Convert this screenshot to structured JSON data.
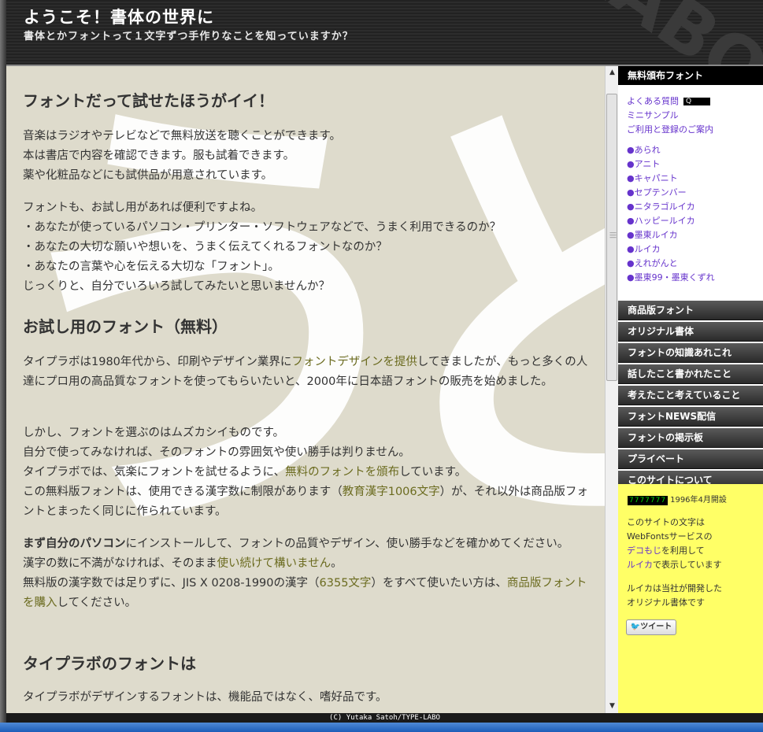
{
  "header": {
    "title": "ようこそ！書体の世界に",
    "subtitle": "書体とかフォントって１文字ずつ手作りなことを知っていますか？"
  },
  "main": {
    "deco_text": "ありがとう",
    "h1": "フォントだって試せたほうがイイ！",
    "p1_l1": "音楽はラジオやテレビなどで無料放送を聴くことができます。",
    "p1_l2": "本は書店で内容を確認できます。服も試着できます。",
    "p1_l3": "薬や化粧品などにも試供品が用意されています。",
    "p2_l1": "フォントも、お試し用があれば便利ですよね。",
    "p2_l2": "・あなたが使っているパソコン・プリンター・ソフトウェアなどで、うまく利用できるのか？",
    "p2_l3": "・あなたの大切な願いや想いを、うまく伝えてくれるフォントなのか？",
    "p2_l4": "・あなたの言葉や心を伝える大切な「フォント」。",
    "p2_l5": "じっくりと、自分でいろいろ試してみたいと思いませんか？",
    "h2": "お試し用のフォント（無料）",
    "p3_a": "タイプラボは1980年代から、印刷やデザイン業界に",
    "p3_link": "フォントデザインを提供",
    "p3_b": "してきましたが、もっと多くの人達にプロ用の高品質なフォントを使ってもらいたいと、2000年に日本語フォントの販売を始めました。",
    "p4_l1": "しかし、フォントを選ぶのはムズカシイものです。",
    "p4_l2": "自分で使ってみなければ、そのフォントの雰囲気や使い勝手は判りません。",
    "p4_l3a": "タイプラボでは、気楽にフォントを試せるように、",
    "p4_l3link": "無料のフォントを頒布",
    "p4_l3b": "しています。",
    "p4_l4a": "この無料版フォントは、使用できる漢字数に制限があります（",
    "p4_l4link": "教育漢字1006文字",
    "p4_l4b": "）が、それ以外は商品版フォントとまったく同じに作られています。",
    "p5_bold": "まず自分のパソコン",
    "p5_l1b": "にインストールして、フォントの品質やデザイン、使い勝手などを確かめてください。",
    "p5_l2a": "漢字の数に不満がなければ、そのまま",
    "p5_l2link": "使い続けて構いません",
    "p5_l2b": "。",
    "p5_l3a": "無料版の漢字数では足りずに、JIS X 0208-1990の漢字（",
    "p5_l3link": "6355文字",
    "p5_l3b": "）をすべて使いたい方は、",
    "p5_l3link2": "商品版フォントを購入",
    "p5_l3c": "してください。",
    "h3": "タイプラボのフォントは",
    "p6_l1": "タイプラボがデザインするフォントは、機能品ではなく、嗜好品です。"
  },
  "sidebar": {
    "head": "無料頒布フォント",
    "links": [
      "よくある質問",
      "ミニサンプル",
      "ご利用と登録のご案内"
    ],
    "q_badge": "Q",
    "fonts": [
      "●あられ",
      "●アニト",
      "●キャパニト",
      "●セプテンバー",
      "●ニタラゴルイカ",
      "●ハッピールイカ",
      "●墨東ルイカ",
      "●ルイカ",
      "●えれがんと",
      "●墨東99・墨東くずれ"
    ],
    "menu": [
      "商品版フォント",
      "オリジナル書体",
      "フォントの知識あれこれ",
      "話したこと書かれたこと",
      "考えたこと考えていること",
      "フォントNEWS配信",
      "フォントの掲示板",
      "プライベート",
      "このサイトについて"
    ],
    "counter": "7777777",
    "since": "1996年4月開設",
    "info_l1": "このサイトの文字は",
    "info_l2": "WebFontsサービスの",
    "info_l3a": "デコもじ",
    "info_l3b": "を利用して",
    "info_l4a": "ルイカ",
    "info_l4b": "で表示しています",
    "info_l5": "ルイカは当社が開発した",
    "info_l6": "オリジナル書体です",
    "tweet": "ツイート"
  },
  "footer": "(C) Yutaka Satoh/TYPE-LABO"
}
